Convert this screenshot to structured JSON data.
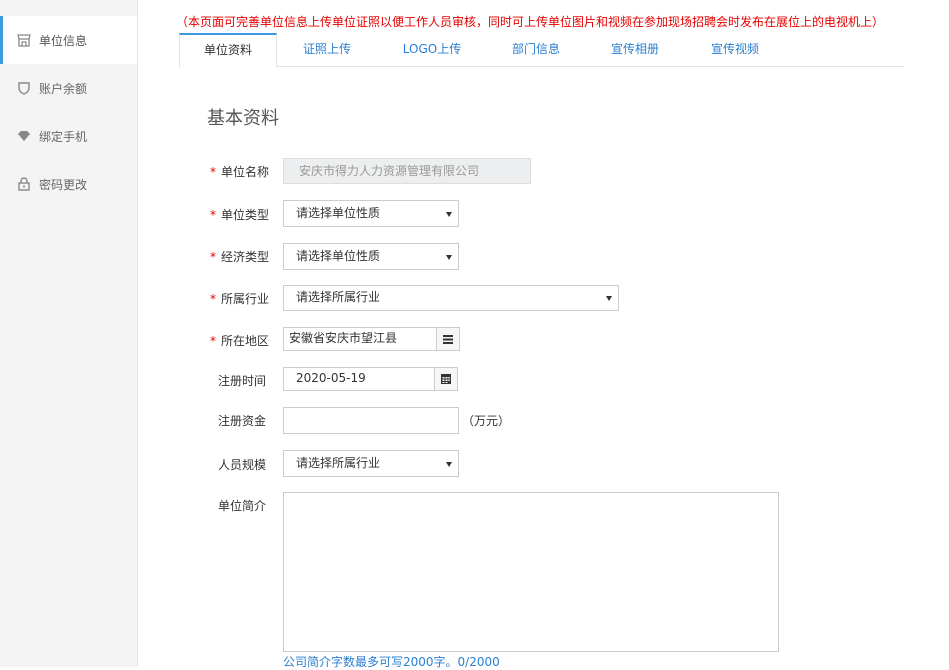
{
  "sidebar": {
    "items": [
      {
        "label": "单位信息",
        "icon": "store-icon",
        "active": true
      },
      {
        "label": "账户余额",
        "icon": "shield-icon",
        "active": false
      },
      {
        "label": "绑定手机",
        "icon": "diamond-icon",
        "active": false
      },
      {
        "label": "密码更改",
        "icon": "lock-icon",
        "active": false
      }
    ]
  },
  "notice": "（本页面可完善单位信息上传单位证照以便工作人员审核，同时可上传单位图片和视频在参加现场招聘会时发布在展位上的电视机上）",
  "tabs": [
    "单位资料",
    "证照上传",
    "LOGO上传",
    "部门信息",
    "宣传相册",
    "宣传视频"
  ],
  "section_title": "基本资料",
  "form": {
    "company_name": {
      "label": "单位名称",
      "required": true,
      "value": "安庆市得力人力资源管理有限公司"
    },
    "unit_type": {
      "label": "单位类型",
      "required": true,
      "value": "请选择单位性质"
    },
    "economic_type": {
      "label": "经济类型",
      "required": true,
      "value": "请选择单位性质"
    },
    "industry": {
      "label": "所属行业",
      "required": true,
      "value": "请选择所属行业"
    },
    "region": {
      "label": "所在地区",
      "required": true,
      "value": "安徽省安庆市望江县"
    },
    "register_date": {
      "label": "注册时间",
      "required": false,
      "value": "2020-05-19"
    },
    "capital": {
      "label": "注册资金",
      "required": false,
      "value": "",
      "unit": "（万元）"
    },
    "staff_size": {
      "label": "人员规模",
      "required": false,
      "value": "请选择所属行业"
    },
    "intro": {
      "label": "单位简介",
      "required": false,
      "value": "",
      "hint": "公司简介字数最多可写2000字。0/2000"
    }
  },
  "colors": {
    "accent": "#3b9be0",
    "link": "#2b7fd0",
    "required": "#e60000"
  }
}
